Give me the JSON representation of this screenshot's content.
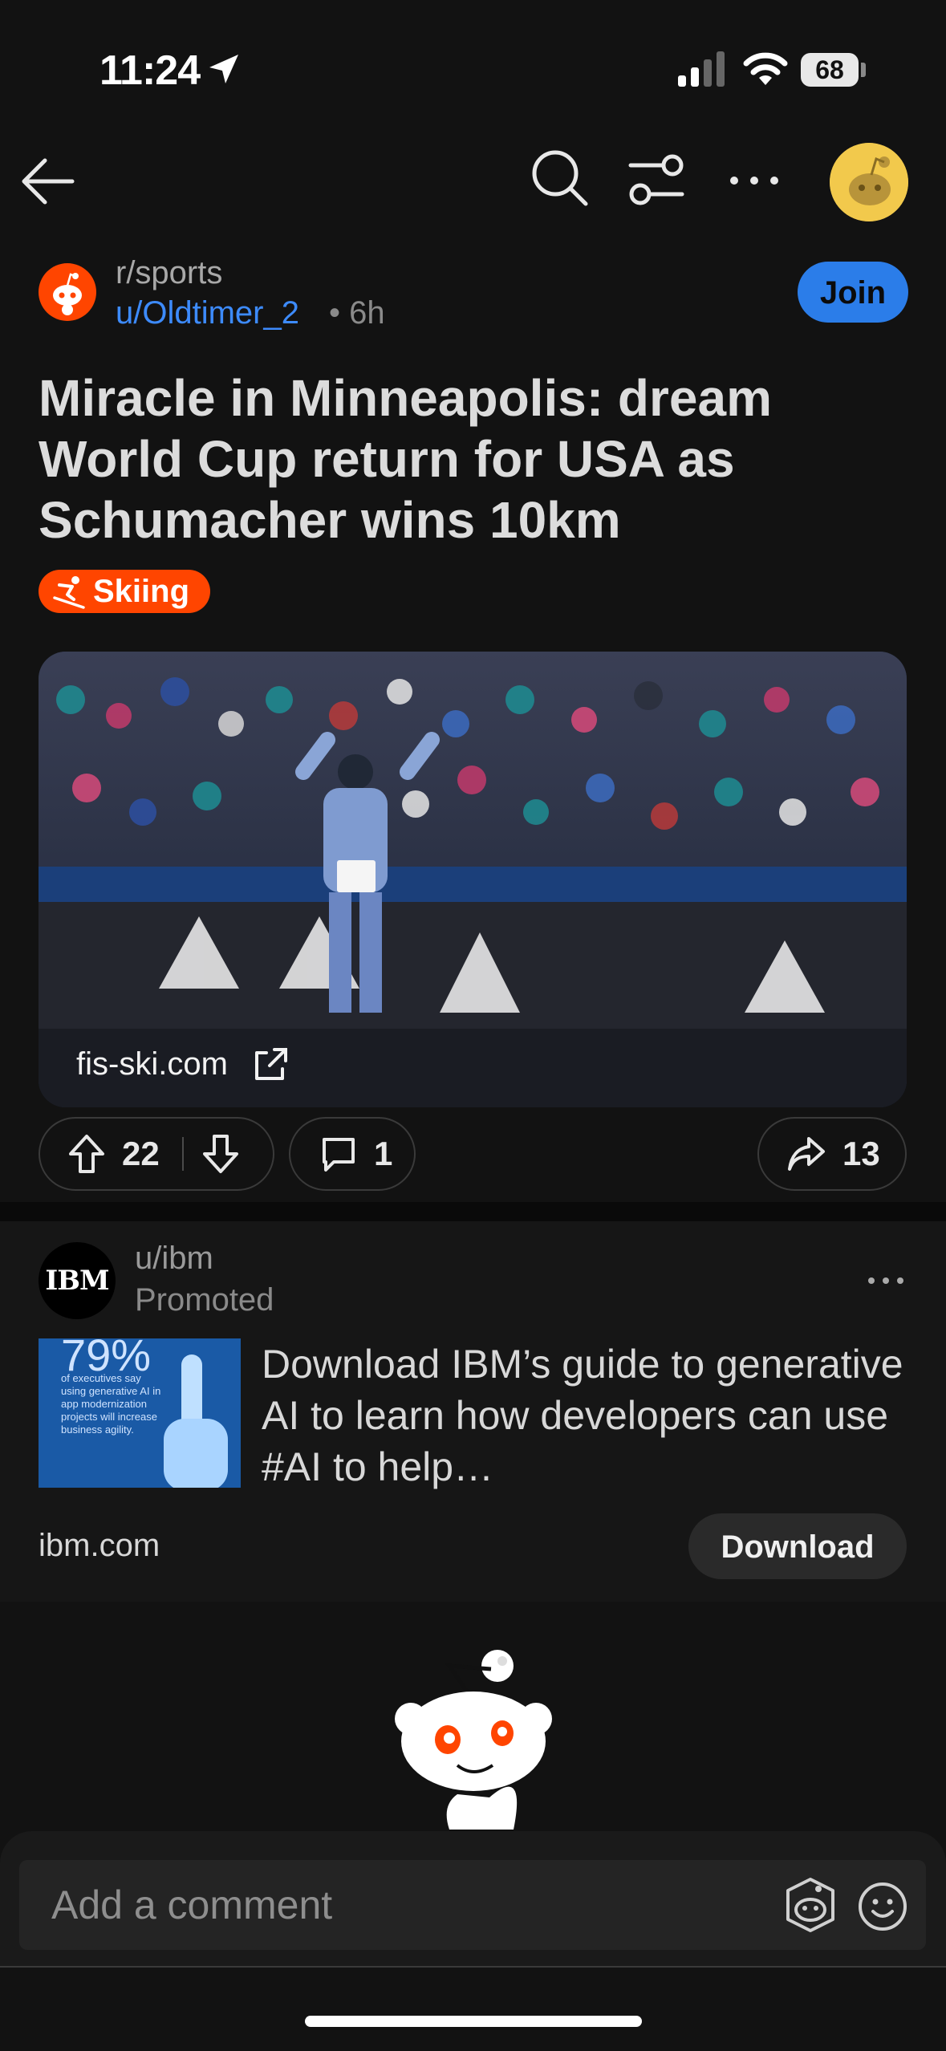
{
  "status": {
    "time": "11:24",
    "battery": "68"
  },
  "post": {
    "subreddit": "r/sports",
    "author": "u/Oldtimer_2",
    "age": "• 6h",
    "join_label": "Join",
    "title": "Miracle in Minneapolis: dream World Cup return for USA as Schumacher wins 10km",
    "flair": "Skiing",
    "link_domain": "fis-ski.com",
    "upvotes": "22",
    "comments": "1",
    "shares": "13"
  },
  "ad": {
    "user": "u/ibm",
    "label": "Promoted",
    "logo_text": "IBM",
    "thumb_percent": "79%",
    "thumb_caption": "of executives say using generative AI in app modernization projects will increase business agility.",
    "text": "Download IBM’s guide to generative AI to learn how developers can use #AI to help…",
    "domain": "ibm.com",
    "cta": "Download"
  },
  "comment_box": {
    "placeholder": "Add a comment"
  },
  "colors": {
    "accent_blue": "#2b7de9",
    "reddit_orange": "#ff4500",
    "background": "#121212"
  }
}
